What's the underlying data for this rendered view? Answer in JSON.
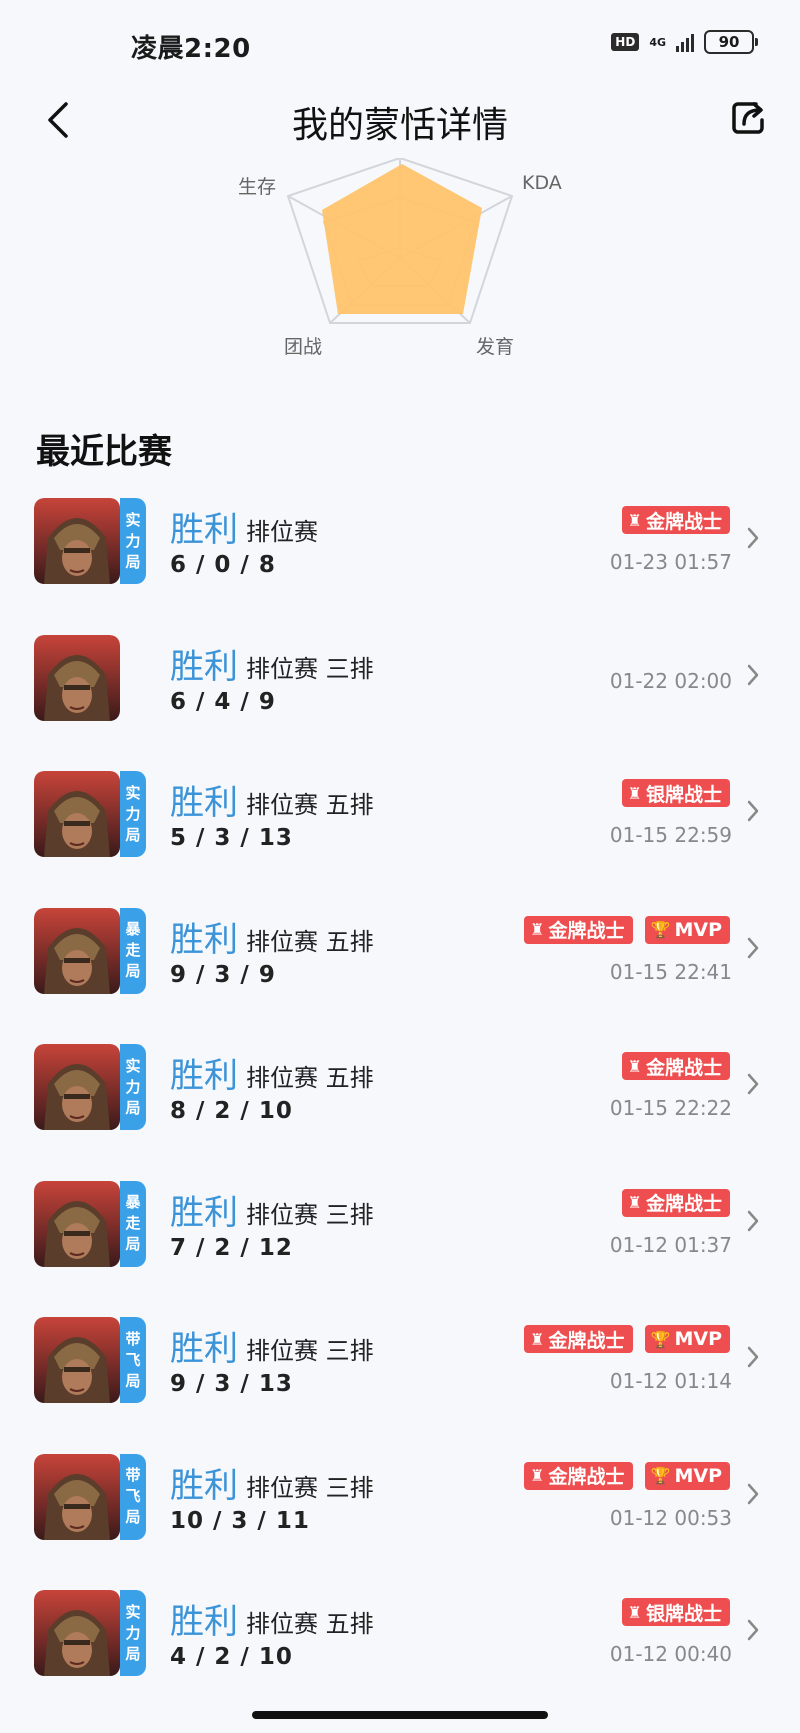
{
  "status_bar": {
    "time": "凌晨2:20",
    "hd": "HD",
    "network": "4G",
    "battery": "90"
  },
  "header": {
    "title": "我的蒙恬详情"
  },
  "radar": {
    "labels": [
      "生存",
      "KDA",
      "发育",
      "团战"
    ],
    "fill_color": "#ffc36b"
  },
  "section_title": "最近比赛",
  "matches": [
    {
      "result": "胜利",
      "mode": "排位赛",
      "kda": "6 / 0 / 8",
      "tag": [
        "实",
        "力",
        "局"
      ],
      "badges": [
        "金牌战士"
      ],
      "time": "01-23 01:57"
    },
    {
      "result": "胜利",
      "mode": "排位赛 三排",
      "kda": "6 / 4 / 9",
      "tag": [],
      "badges": [],
      "time": "01-22 02:00"
    },
    {
      "result": "胜利",
      "mode": "排位赛 五排",
      "kda": "5 / 3 / 13",
      "tag": [
        "实",
        "力",
        "局"
      ],
      "badges": [
        "银牌战士"
      ],
      "time": "01-15 22:59"
    },
    {
      "result": "胜利",
      "mode": "排位赛 五排",
      "kda": "9 / 3 / 9",
      "tag": [
        "暴",
        "走",
        "局"
      ],
      "badges": [
        "金牌战士",
        "MVP"
      ],
      "time": "01-15 22:41"
    },
    {
      "result": "胜利",
      "mode": "排位赛 五排",
      "kda": "8 / 2 / 10",
      "tag": [
        "实",
        "力",
        "局"
      ],
      "badges": [
        "金牌战士"
      ],
      "time": "01-15 22:22"
    },
    {
      "result": "胜利",
      "mode": "排位赛 三排",
      "kda": "7 / 2 / 12",
      "tag": [
        "暴",
        "走",
        "局"
      ],
      "badges": [
        "金牌战士"
      ],
      "time": "01-12 01:37"
    },
    {
      "result": "胜利",
      "mode": "排位赛 三排",
      "kda": "9 / 3 / 13",
      "tag": [
        "带",
        "飞",
        "局"
      ],
      "badges": [
        "金牌战士",
        "MVP"
      ],
      "time": "01-12 01:14"
    },
    {
      "result": "胜利",
      "mode": "排位赛 三排",
      "kda": "10 / 3 / 11",
      "tag": [
        "带",
        "飞",
        "局"
      ],
      "badges": [
        "金牌战士",
        "MVP"
      ],
      "time": "01-12 00:53"
    },
    {
      "result": "胜利",
      "mode": "排位赛 五排",
      "kda": "4 / 2 / 10",
      "tag": [
        "实",
        "力",
        "局"
      ],
      "badges": [
        "银牌战士"
      ],
      "time": "01-12 00:40"
    }
  ],
  "colors": {
    "win": "#3b93d8",
    "badge": "#ee4e4f",
    "mode_tag": "#3aa0e8"
  }
}
